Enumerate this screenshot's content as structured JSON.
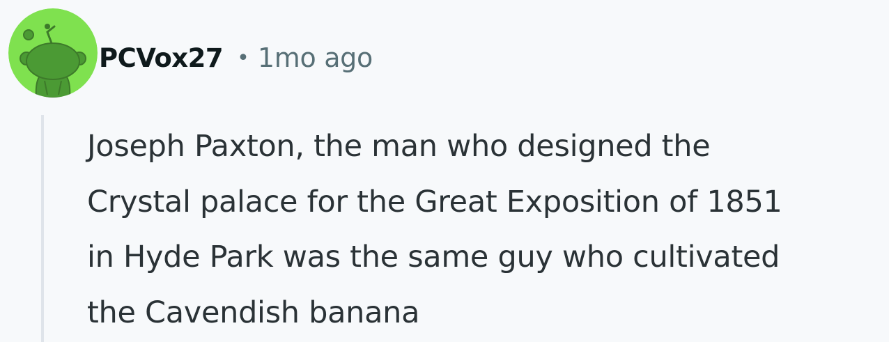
{
  "comment": {
    "author": "PCVox27",
    "separator": "•",
    "timestamp": "1mo ago",
    "avatar_icon": "snoo-avatar-icon",
    "avatar_color": "#7fe14f",
    "body_lines": [
      "Joseph Paxton, the man who designed the",
      "Crystal palace for the Great Exposition of 1851",
      "in Hyde Park was the same guy who cultivated",
      "the Cavendish banana"
    ]
  },
  "colors": {
    "background": "#f7f9fb",
    "username": "#0f1a1c",
    "meta": "#576f76",
    "body_text": "#2a3236",
    "thread_line": "#dfe4ea"
  }
}
